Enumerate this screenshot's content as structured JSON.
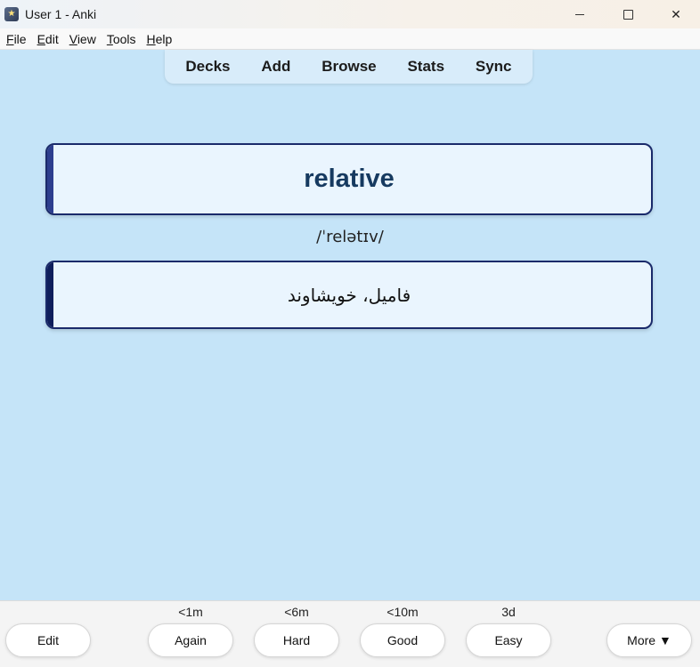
{
  "window": {
    "title": "User 1 - Anki",
    "minimize_glyph": "",
    "close_glyph": "✕"
  },
  "menu": [
    {
      "acc": "F",
      "rest": "ile"
    },
    {
      "acc": "E",
      "rest": "dit"
    },
    {
      "acc": "V",
      "rest": "iew"
    },
    {
      "acc": "T",
      "rest": "ools"
    },
    {
      "acc": "H",
      "rest": "elp"
    }
  ],
  "toolbar": {
    "decks": "Decks",
    "add": "Add",
    "browse": "Browse",
    "stats": "Stats",
    "sync": "Sync"
  },
  "card": {
    "word": "relative",
    "phonetic": "/ˈrelətɪv/",
    "meaning": "فامیل، خویشاوند"
  },
  "bottom": {
    "edit_label": "Edit",
    "more_label": "More ▼",
    "answers": [
      {
        "label": "Again",
        "interval": "<1m"
      },
      {
        "label": "Hard",
        "interval": "<6m"
      },
      {
        "label": "Good",
        "interval": "<10m"
      },
      {
        "label": "Easy",
        "interval": "3d"
      }
    ]
  },
  "colors": {
    "background": "#c5e4f8",
    "card_border": "#1a2a6a",
    "word_color": "#163a60"
  }
}
